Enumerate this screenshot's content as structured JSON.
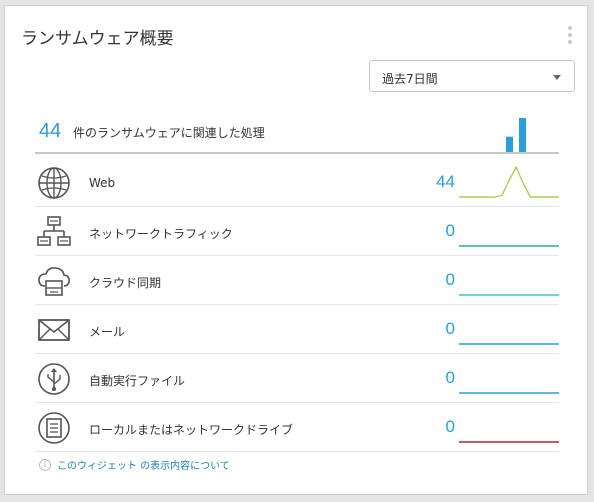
{
  "widget": {
    "title": "ランサムウェア概要",
    "range_select": {
      "value": "過去7日間"
    },
    "summary": {
      "count": "44",
      "text": "件のランサムウェアに関連した処理",
      "bars": [
        0.45,
        1.0
      ]
    },
    "rows": [
      {
        "icon": "globe-icon",
        "label": "Web",
        "count": "44",
        "spark_color": "#a6cf52",
        "spark": [
          0,
          0,
          0,
          0,
          0,
          0,
          0.05,
          0.55,
          1.0,
          0.45,
          0,
          0,
          0,
          0,
          0
        ]
      },
      {
        "icon": "network-icon",
        "label": "ネットワークトラフィック",
        "count": "0",
        "spark_color": "#2bb28c",
        "spark": [
          0
        ]
      },
      {
        "icon": "cloud-sync-icon",
        "label": "クラウド同期",
        "count": "0",
        "spark_color": "#3cc6c0",
        "spark": [
          0
        ]
      },
      {
        "icon": "mail-icon",
        "label": "メール",
        "count": "0",
        "spark_color": "#2a9fd6",
        "spark": [
          0
        ]
      },
      {
        "icon": "usb-icon",
        "label": "自動実行ファイル",
        "count": "0",
        "spark_color": "#2a9fd6",
        "spark": [
          0
        ]
      },
      {
        "icon": "drive-icon",
        "label": "ローカルまたはネットワークドライブ",
        "count": "0",
        "spark_color": "#b0272d",
        "spark": [
          0
        ]
      }
    ],
    "footer_link": "このウィジェット の表示内容について",
    "colors": {
      "accent": "#2a9fd6"
    }
  }
}
